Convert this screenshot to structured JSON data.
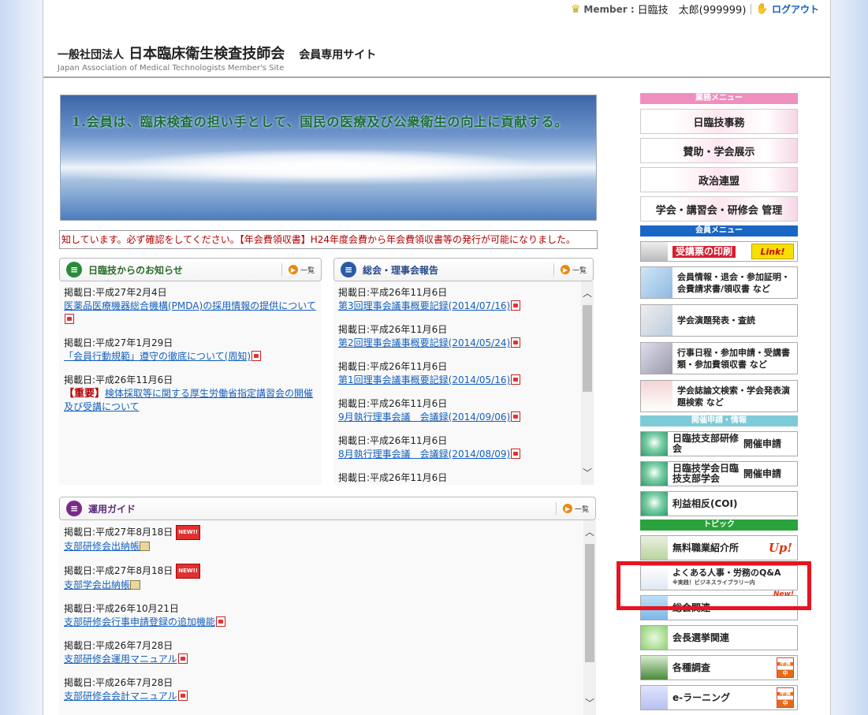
{
  "header": {
    "member_label": "Member :",
    "member_name": "日臨技　太郎(999999)",
    "logout": "ログアウト",
    "org_prefix": "一般社団法人",
    "org_name": "日本臨床衛生検査技師会",
    "site_name": "会員専用サイト",
    "org_en": "Japan Association of Medical Technologists Member's Site"
  },
  "banner_text": "1.会員は、臨床検査の担い手として、国民の医療及び公衆衛生の向上に貢献する。",
  "ticker": "知しています。必ず確認をしてください。【年会費領収書】H24年度会費から年会費領収書等の発行が可能になりました。",
  "more_label": "一覧",
  "news": {
    "title": "日臨技からのお知らせ",
    "items": [
      {
        "date": "掲載日:平成27年2月4日",
        "text": "医薬品医療機器総合機構(PMDA)の採用情報の提供について"
      },
      {
        "date": "掲載日:平成27年1月29日",
        "text": "「会員行動規範」遵守の徹底について(周知)"
      },
      {
        "date": "掲載日:平成26年11月6日",
        "tag": "【重要】",
        "text": "検体採取等に関する厚生労働省指定講習会の開催及び受講について"
      }
    ]
  },
  "board": {
    "title": "総会・理事会報告",
    "items": [
      {
        "date": "掲載日:平成26年11月6日",
        "text": "第3回理事会議事概要記録(2014/07/16)"
      },
      {
        "date": "掲載日:平成26年11月6日",
        "text": "第2回理事会議事概要記録(2014/05/24)"
      },
      {
        "date": "掲載日:平成26年11月6日",
        "text": "第1回理事会議事概要記録(2014/05/16)"
      },
      {
        "date": "掲載日:平成26年11月6日",
        "text": "9月執行理事会議　会議録(2014/09/06)"
      },
      {
        "date": "掲載日:平成26年11月6日",
        "text": "8月執行理事会議　会議録(2014/08/09)"
      },
      {
        "date": "掲載日:平成26年11月6日",
        "text": ""
      }
    ]
  },
  "guide": {
    "title": "運用ガイド",
    "new_label": "NEW!!",
    "items": [
      {
        "date": "掲載日:平成27年8月18日",
        "text": "支部研修会出納帳"
      },
      {
        "date": "掲載日:平成27年8月18日",
        "text": "支部学会出納帳"
      },
      {
        "date": "掲載日:平成26年10月21日",
        "text": "支部研修会行事申請登録の追加機能"
      },
      {
        "date": "掲載日:平成26年7月28日",
        "text": "支部研修会運用マニュアル"
      },
      {
        "date": "掲載日:平成26年7月28日",
        "text": "支部研修会会計マニュアル"
      }
    ]
  },
  "sidebar": {
    "business_header": "業務メニュー",
    "business": [
      "日臨技事務",
      "賛助・学会展示",
      "政治連盟",
      "学会・講習会・研修会 管理"
    ],
    "member_header": "会員メニュー",
    "member_items": [
      {
        "label": "受講票の印刷",
        "badge": "Link!"
      },
      {
        "label": "会員情報・退会・参加証明・会費請求書/領収書 など"
      },
      {
        "label": "学会演題発表・査読"
      },
      {
        "label": "行事日程・参加申請・受講書類・参加費領収書 など"
      },
      {
        "label": "学会誌論文検索・学会発表演題検索 など"
      }
    ],
    "event_header": "開催申請・情報",
    "events": [
      {
        "label": "日臨技支部研修会",
        "action": "開催申請"
      },
      {
        "label": "日臨技学会日臨技支部学会",
        "action": "開催申請"
      },
      {
        "label": "利益相反(COI)"
      }
    ],
    "topic_header": "トピック",
    "topics": [
      {
        "label": "無料職業紹介所",
        "badge": "Up!"
      },
      {
        "label": "よくある人事・労務のQ&A",
        "sub": "※実践！ビジネスライブラリー内",
        "badge": "New!"
      },
      {
        "label": "総会関連"
      },
      {
        "label": "会長選挙関連"
      },
      {
        "label": "各種調査",
        "badge": "準備中"
      },
      {
        "label": "e-ラーニング",
        "badge": "準備中"
      }
    ]
  },
  "colors": {
    "business_header": "#ee8fc0",
    "member_header": "#1a66c4",
    "event_header": "#7ecbd8",
    "topic_header": "#2aa33c",
    "highlight": "#e8141f"
  }
}
